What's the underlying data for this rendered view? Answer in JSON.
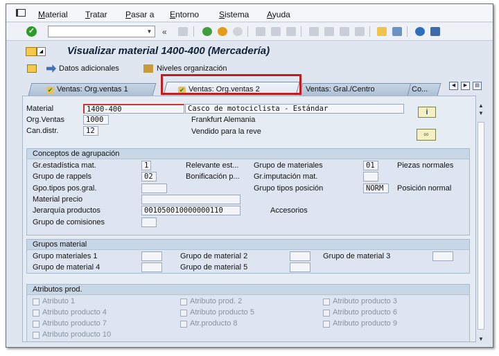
{
  "menu": [
    "Material",
    "Tratar",
    "Pasar a",
    "Entorno",
    "Sistema",
    "Ayuda"
  ],
  "toolbar": {
    "command_value": "",
    "back_label": "«"
  },
  "title": "Visualizar material 1400-400 (Mercadería)",
  "app_toolbar": {
    "additional_data": "Datos adicionales",
    "org_levels": "Niveles organización"
  },
  "tabs": [
    {
      "label": "Ventas: Org.ventas 1",
      "active": false
    },
    {
      "label": "Ventas: Org.ventas 2",
      "active": true
    },
    {
      "label": "Ventas: Gral./Centro",
      "active": false
    },
    {
      "label": "Co...",
      "active": false
    }
  ],
  "header": {
    "material_label": "Material",
    "material_value": "1400-400",
    "material_desc": "Casco de motociclista - Estándar",
    "org_label": "Org.Ventas",
    "org_value": "1000",
    "org_desc": "Frankfurt Alemania",
    "channel_label": "Can.distr.",
    "channel_value": "12",
    "channel_desc": "Vendido para la reve"
  },
  "grouping": {
    "title": "Conceptos de agrupación",
    "stat_group_label": "Gr.estadística mat.",
    "stat_group_value": "1",
    "relevant_label": "Relevante est...",
    "mat_group_label": "Grupo de materiales",
    "mat_group_value": "01",
    "mat_group_desc": "Piezas normales",
    "rebate_label": "Grupo de rappels",
    "rebate_value": "02",
    "bonus_label": "Bonificación p...",
    "acct_label": "Gr.imputación mat.",
    "acct_value": "",
    "item_cat_label": "Gpo.tipos pos.gral.",
    "item_cat_value": "",
    "item_type_label": "Grupo tipos posición",
    "item_type_value": "NORM",
    "item_type_desc": "Posición normal",
    "price_label": "Material precio",
    "price_value": "",
    "hierarchy_label": "Jerarquía productos",
    "hierarchy_value": "001050010000000110",
    "hierarchy_desc": "Accesorios",
    "commission_label": "Grupo de comisiones",
    "commission_value": ""
  },
  "material_groups": {
    "title": "Grupos material",
    "g1": "Grupo materiales 1",
    "g2": "Grupo de material 2",
    "g3": "Grupo de material 3",
    "g4": "Grupo de material 4",
    "g5": "Grupo de material 5"
  },
  "attributes": {
    "title": "Atributos prod.",
    "items": [
      "Atributo 1",
      "Atributo prod. 2",
      "Atributo producto 3",
      "Atributo producto 4",
      "Atributo producto 5",
      "Atributo producto 6",
      "Atributo producto 7",
      "Atr.producto 8",
      "Atributo producto 9",
      "Atributo producto 10"
    ]
  }
}
